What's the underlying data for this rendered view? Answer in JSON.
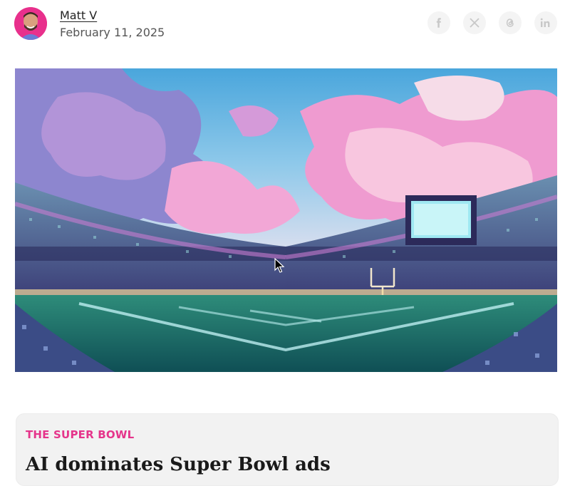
{
  "author": {
    "name": "Matt V",
    "date": "February 11, 2025",
    "avatar_icon": "avatar-photo"
  },
  "social": [
    {
      "icon": "facebook-icon",
      "glyph": "f"
    },
    {
      "icon": "x-icon",
      "glyph": "X"
    },
    {
      "icon": "threads-icon",
      "glyph": "@"
    },
    {
      "icon": "linkedin-icon",
      "glyph": "in"
    }
  ],
  "hero": {
    "description_icon": "pixel-art-stadium-image"
  },
  "article": {
    "category": "THE SUPER BOWL",
    "headline": "AI dominates Super Bowl ads"
  },
  "colors": {
    "accent": "#e5348b",
    "card_bg": "#f2f2f2",
    "social_bg": "#f4f4f4"
  }
}
